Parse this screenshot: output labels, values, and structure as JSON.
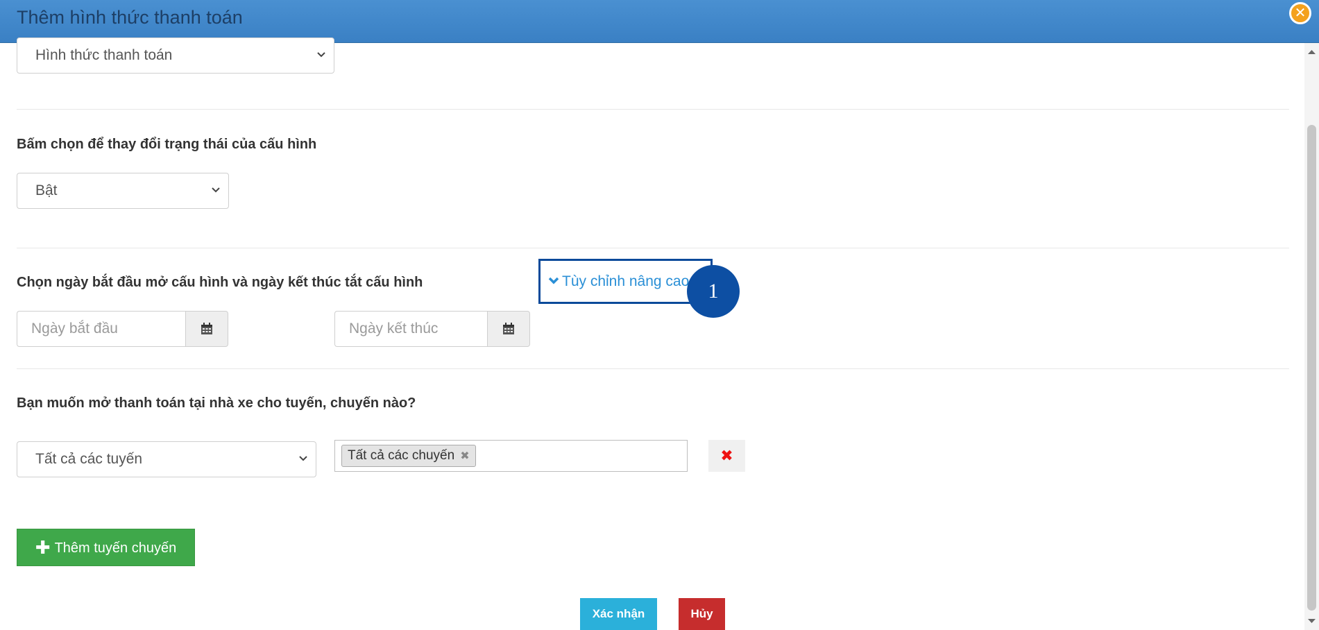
{
  "header": {
    "title": "Thêm hình thức thanh toán"
  },
  "payment_method_select": {
    "value": "Hình thức thanh toán"
  },
  "status_section": {
    "label": "Bấm chọn để thay đổi trạng thái của cấu hình",
    "select_value": "Bật"
  },
  "date_section": {
    "label": "Chọn ngày bắt đầu mở cấu hình và ngày kết thúc tắt cấu hình",
    "start_placeholder": "Ngày bắt đầu",
    "end_placeholder": "Ngày kết thúc",
    "advanced_link": "Tùy chỉnh nâng cao",
    "annotation_number": "1"
  },
  "route_section": {
    "label": "Bạn muốn mở thanh toán tại nhà xe cho tuyến, chuyến nào?",
    "route_select_value": "Tất cả các tuyến",
    "trip_tag": "Tất cả các chuyến",
    "tag_remove_symbol": "✖",
    "row_remove_symbol": "✖"
  },
  "add_route_button": {
    "plus": "✚",
    "label": "Thêm tuyến chuyến"
  },
  "footer": {
    "confirm_label": "Xác nhận",
    "cancel_label": "Hủy"
  },
  "colors": {
    "header": "#3a80c4",
    "add_button": "#3fa84a",
    "confirm_button": "#2bb0da",
    "cancel_button": "#c62d2d",
    "annotation": "#0d4fa3"
  }
}
